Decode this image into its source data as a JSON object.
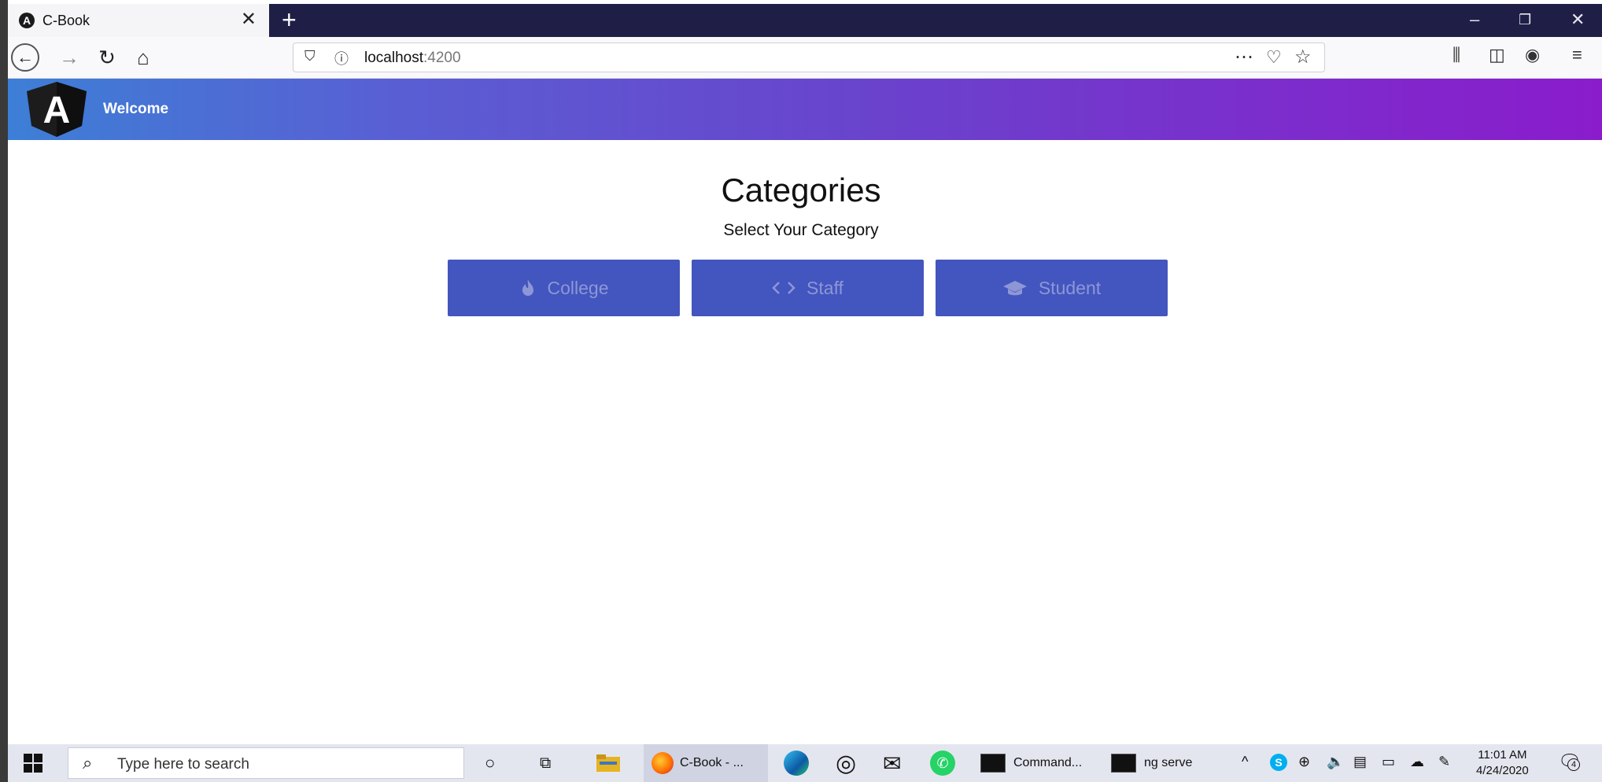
{
  "browser": {
    "tab_title": "C-Book",
    "tab_favicon_letter": "A",
    "url_host": "localhost",
    "url_port": ":4200"
  },
  "app": {
    "header_label": "Welcome",
    "logo_letter": "A",
    "title": "Categories",
    "subtitle": "Select Your Category",
    "categories": [
      {
        "label": "College",
        "icon": "fire-icon"
      },
      {
        "label": "Staff",
        "icon": "code-icon"
      },
      {
        "label": "Student",
        "icon": "graduation-cap-icon"
      }
    ],
    "colors": {
      "button_bg": "#4355bf",
      "button_text": "#8d97d6",
      "header_gradient_start": "#3d7fd6",
      "header_gradient_end": "#8a1ccc"
    }
  },
  "taskbar": {
    "search_placeholder": "Type here to search",
    "firefox_label": "C-Book - ...",
    "cmd_label": "Command...",
    "ng_label": "ng serve",
    "notification_count": "4",
    "time": "11:01 AM",
    "date": "4/24/2020"
  }
}
